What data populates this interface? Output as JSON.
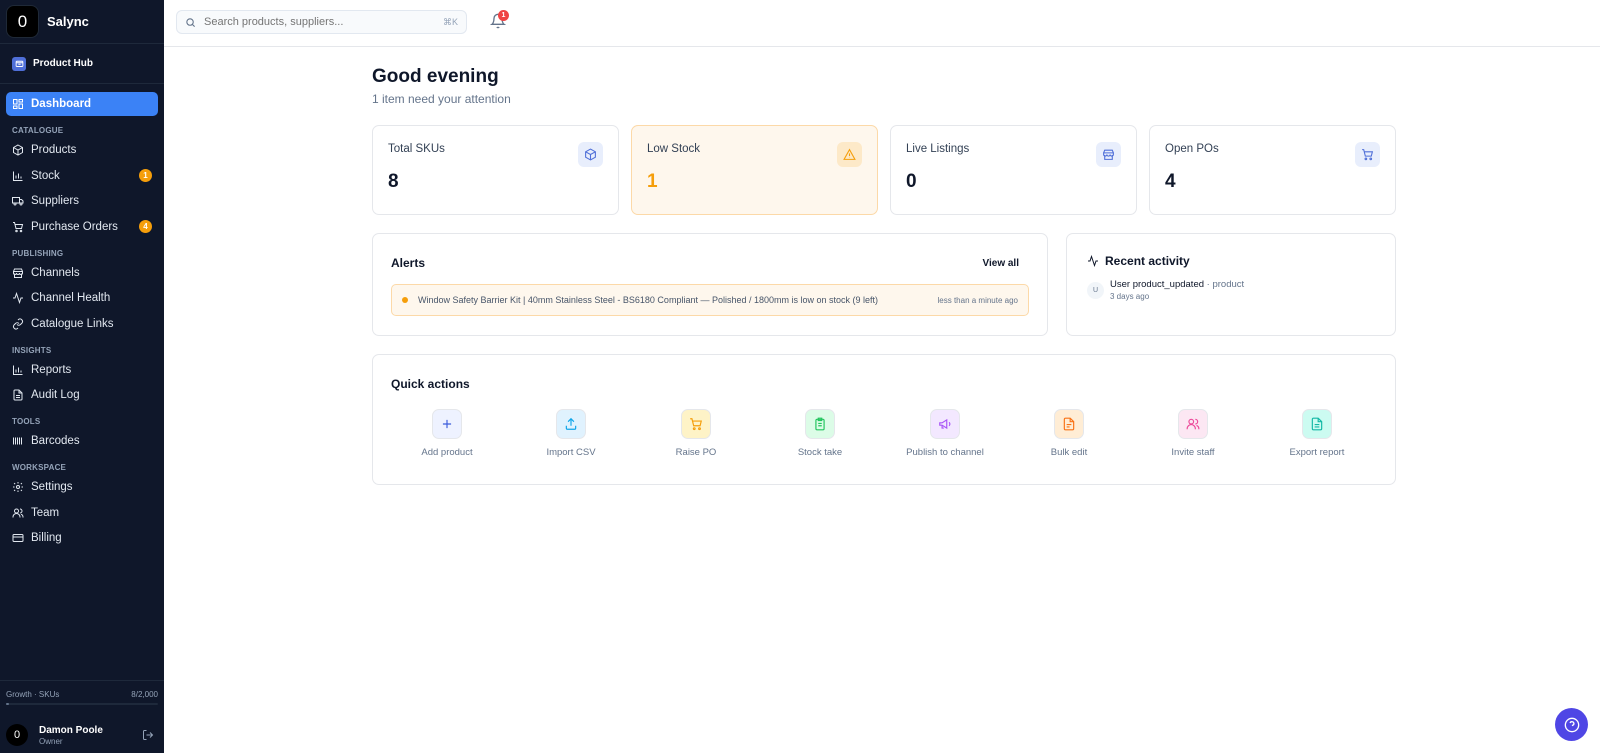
{
  "brand": {
    "logo": "0",
    "name": "Salync"
  },
  "hub": {
    "label": "Product Hub",
    "icon": "box-icon"
  },
  "nav": {
    "dashboard": "Dashboard",
    "sections": {
      "catalogue": "CATALOGUE",
      "publishing": "PUBLISHING",
      "insights": "INSIGHTS",
      "tools": "TOOLS",
      "workspace": "WORKSPACE"
    },
    "products": "Products",
    "stock": "Stock",
    "stock_badge": "1",
    "suppliers": "Suppliers",
    "purchase_orders": "Purchase Orders",
    "purchase_orders_badge": "4",
    "channels": "Channels",
    "channel_health": "Channel Health",
    "catalogue_links": "Catalogue Links",
    "reports": "Reports",
    "audit_log": "Audit Log",
    "barcodes": "Barcodes",
    "settings": "Settings",
    "team": "Team",
    "billing": "Billing"
  },
  "plan": {
    "label": "Growth · SKUs",
    "usage": "8/2,000",
    "used_fraction": 0.004
  },
  "user": {
    "avatar": "0",
    "name": "Damon Poole",
    "role": "Owner"
  },
  "search": {
    "placeholder": "Search products, suppliers...",
    "shortcut": "⌘K"
  },
  "notifications": {
    "count": "1"
  },
  "header": {
    "greeting": "Good evening",
    "subtitle": "1 item need your attention"
  },
  "stats": [
    {
      "label": "Total SKUs",
      "value": "8",
      "icon": "cube-icon"
    },
    {
      "label": "Low Stock",
      "value": "1",
      "icon": "warning-icon"
    },
    {
      "label": "Live Listings",
      "value": "0",
      "icon": "store-icon"
    },
    {
      "label": "Open POs",
      "value": "4",
      "icon": "cart-icon"
    }
  ],
  "alerts": {
    "title": "Alerts",
    "view_all": "View all",
    "items": [
      {
        "text": "Window Safety Barrier Kit | 40mm Stainless Steel - BS6180 Compliant — Polished / 1800mm is low on stock (9 left)",
        "time": "less than a minute ago"
      }
    ]
  },
  "activity": {
    "title": "Recent activity",
    "items": [
      {
        "avatar": "U",
        "actor": "User product_updated",
        "target": "· product",
        "time": "3 days ago"
      }
    ]
  },
  "quick_actions": {
    "title": "Quick actions",
    "items": [
      {
        "label": "Add product",
        "icon": "plus-icon",
        "color": "#3b5bdb"
      },
      {
        "label": "Import CSV",
        "icon": "upload-icon",
        "color": "#0ea5e9"
      },
      {
        "label": "Raise PO",
        "icon": "cart-icon",
        "color": "#f59e0b"
      },
      {
        "label": "Stock take",
        "icon": "clipboard-icon",
        "color": "#22c55e"
      },
      {
        "label": "Publish to channel",
        "icon": "megaphone-icon",
        "color": "#a855f7"
      },
      {
        "label": "Bulk edit",
        "icon": "file-edit-icon",
        "color": "#f97316"
      },
      {
        "label": "Invite staff",
        "icon": "users-icon",
        "color": "#ec4899"
      },
      {
        "label": "Export report",
        "icon": "file-text-icon",
        "color": "#14b8a6"
      }
    ]
  },
  "colors": {
    "sidebar_bg": "#0f172a",
    "accent": "#3b82f6",
    "warning": "#f59e0b",
    "danger": "#ef4444",
    "help": "#4f46e5"
  }
}
